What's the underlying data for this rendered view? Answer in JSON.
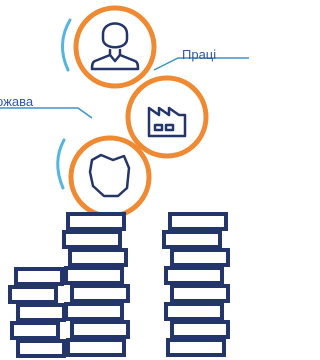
{
  "labels": {
    "worker": "Праці",
    "state": "ржава"
  },
  "icons": {
    "circle_1": "person-icon",
    "circle_2": "factory-icon",
    "circle_3": "country-map-icon",
    "stacks": "coin-stacks-icon"
  },
  "colors": {
    "circle_border": "#ef8a32",
    "icon_stroke": "#24356a",
    "label_text": "#2f58a6",
    "label_line": "#3b93c8",
    "arc_accent": "#56b5df",
    "coin_stroke": "#24356a",
    "coin_fill": "#ffffff"
  }
}
